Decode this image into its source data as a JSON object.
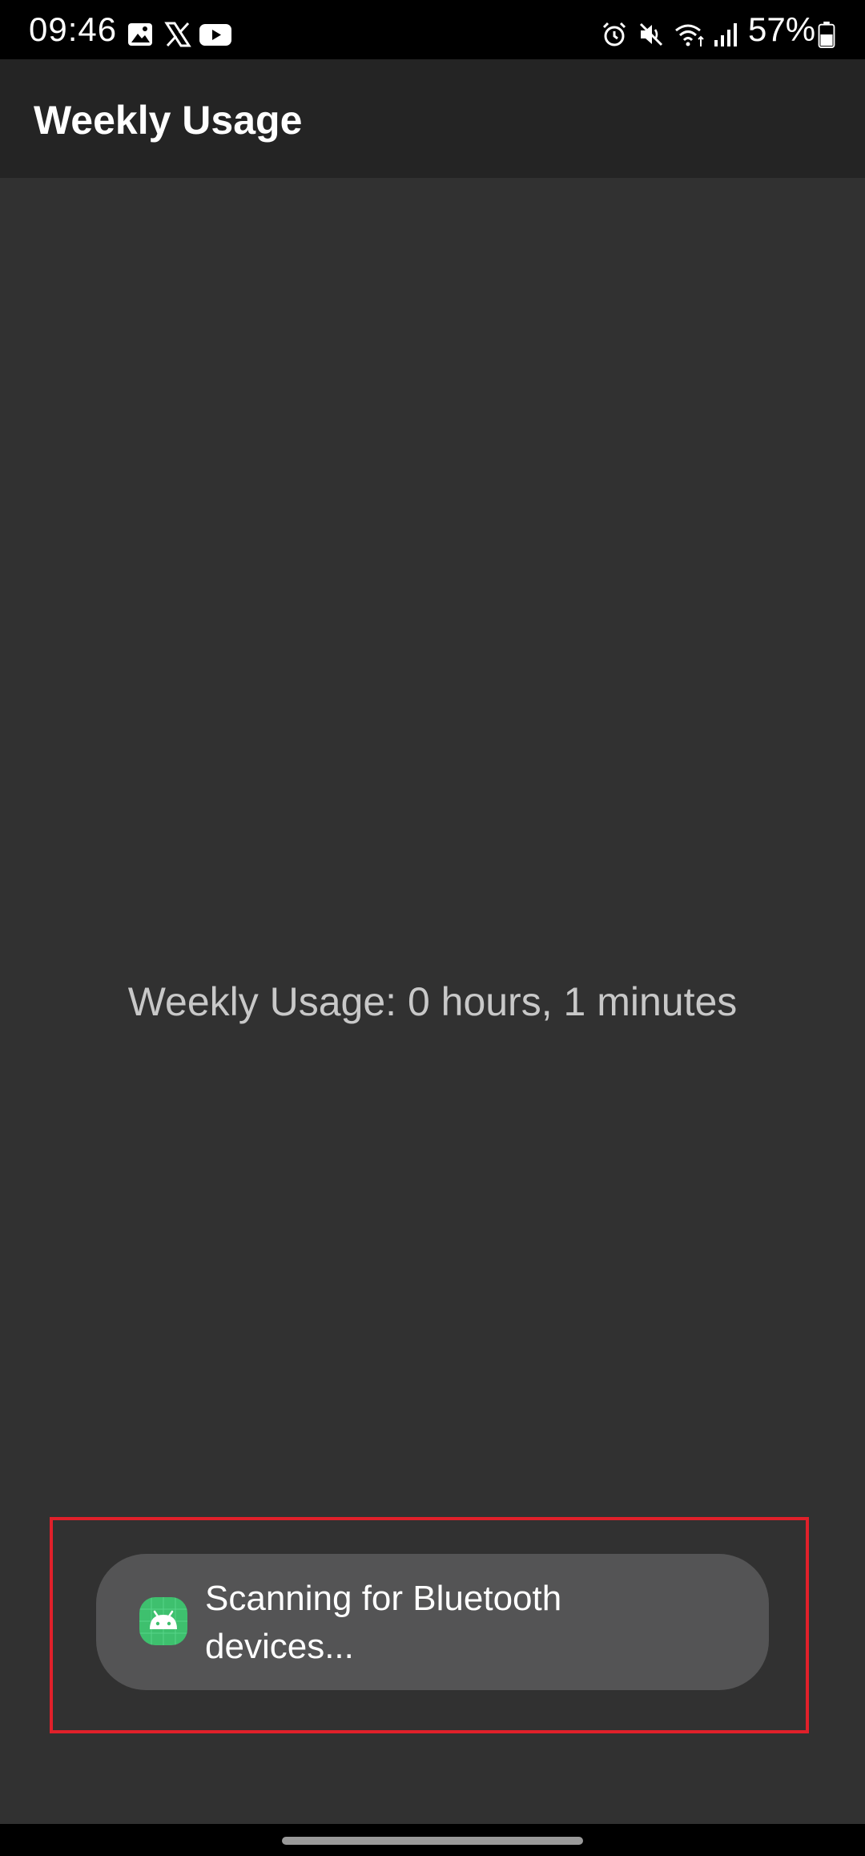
{
  "status_bar": {
    "time": "09:46",
    "battery": "57%",
    "left_icons": [
      "gallery-icon",
      "x-icon",
      "youtube-icon"
    ],
    "right_icons": [
      "alarm-icon",
      "mute-icon",
      "wifi-icon",
      "signal-icon",
      "battery-icon"
    ]
  },
  "app_bar": {
    "title": "Weekly Usage"
  },
  "main": {
    "usage_text": "Weekly Usage: 0 hours, 1 minutes"
  },
  "toast": {
    "message": "Scanning for Bluetooth devices...",
    "icon": "android-icon",
    "icon_color": "#3ec06e"
  },
  "colors": {
    "background": "#313131",
    "app_bar": "#242424",
    "toast": "#545455",
    "highlight": "#e0202a"
  }
}
